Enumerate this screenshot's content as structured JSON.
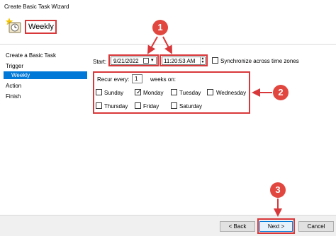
{
  "window": {
    "title": "Create Basic Task Wizard"
  },
  "header": {
    "title": "Weekly"
  },
  "sidebar": {
    "items": [
      {
        "label": "Create a Basic Task"
      },
      {
        "label": "Trigger"
      },
      {
        "label": "Weekly"
      },
      {
        "label": "Action"
      },
      {
        "label": "Finish"
      }
    ]
  },
  "start": {
    "label": "Start:",
    "date_value": "9/21/2022",
    "time_value": "11:20:53 AM",
    "sync_label": "Synchronize across time zones"
  },
  "recur": {
    "label": "Recur every:",
    "value": "1",
    "suffix": "weeks on:"
  },
  "days": [
    {
      "label": "Sunday",
      "checked": false
    },
    {
      "label": "Monday",
      "checked": true
    },
    {
      "label": "Tuesday",
      "checked": false
    },
    {
      "label": "Wednesday",
      "checked": false
    },
    {
      "label": "Thursday",
      "checked": false
    },
    {
      "label": "Friday",
      "checked": false
    },
    {
      "label": "Saturday",
      "checked": false
    }
  ],
  "buttons": {
    "back": "< Back",
    "next": "Next >",
    "cancel": "Cancel"
  },
  "callouts": [
    "1",
    "2",
    "3"
  ],
  "colors": {
    "accent": "#d9383a",
    "selection": "#0078d7",
    "badge": "#e2473f"
  }
}
